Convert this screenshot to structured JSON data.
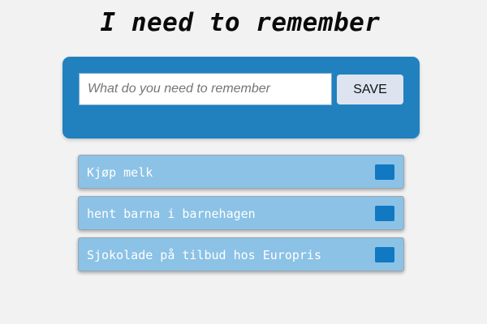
{
  "header": {
    "title": "I need to remember"
  },
  "form": {
    "input_placeholder": "What do you need to remember",
    "input_value": "",
    "save_label": "SAVE"
  },
  "todos": [
    {
      "text": "Kjøp melk",
      "done": false
    },
    {
      "text": "hent barna i barnehagen",
      "done": false
    },
    {
      "text": "Sjokolade på tilbud hos Europris",
      "done": false
    }
  ],
  "colors": {
    "page_background": "#f2f2f2",
    "panel_background": "#2181bf",
    "item_background": "#8bc2e6",
    "checkbox": "#1178c2",
    "button_background": "#dde4f0"
  }
}
